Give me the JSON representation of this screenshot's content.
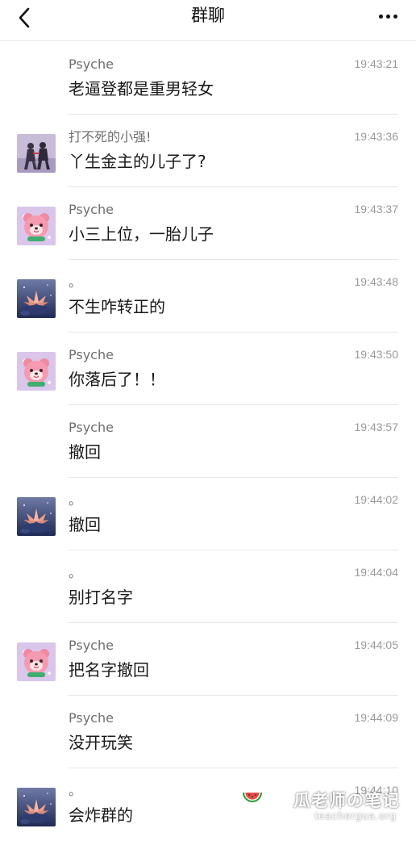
{
  "header": {
    "title": "群聊"
  },
  "messages": [
    {
      "avatar": "none",
      "name": "Psyche",
      "time": "19:43:21",
      "text": "老逼登都是重男轻女"
    },
    {
      "avatar": "anime-silhouette",
      "name": "打不死的小强!",
      "time": "19:43:36",
      "text": "丫生金主的儿子了?"
    },
    {
      "avatar": "pink-bear",
      "name": "Psyche",
      "time": "19:43:37",
      "text": "小三上位，一胎儿子"
    },
    {
      "avatar": "lotus-night",
      "name": "。",
      "time": "19:43:48",
      "text": "不生咋转正的"
    },
    {
      "avatar": "pink-bear",
      "name": "Psyche",
      "time": "19:43:50",
      "text": "你落后了！！"
    },
    {
      "avatar": "none",
      "name": "Psyche",
      "time": "19:43:57",
      "text": "撤回"
    },
    {
      "avatar": "lotus-night",
      "name": "。",
      "time": "19:44:02",
      "text": "撤回"
    },
    {
      "avatar": "none",
      "name": "。",
      "time": "19:44:04",
      "text": "别打名字"
    },
    {
      "avatar": "pink-bear",
      "name": "Psyche",
      "time": "19:44:05",
      "text": "把名字撤回"
    },
    {
      "avatar": "none",
      "name": "Psyche",
      "time": "19:44:09",
      "text": "没开玩笑"
    },
    {
      "avatar": "lotus-night",
      "name": "。",
      "time": "19:44:10",
      "text": "会炸群的"
    }
  ],
  "watermark": {
    "main": "瓜老师の笔记",
    "sub": "teachergua.org"
  },
  "icons": {
    "back": "back-chevron-icon",
    "more": "more-dots-icon"
  }
}
